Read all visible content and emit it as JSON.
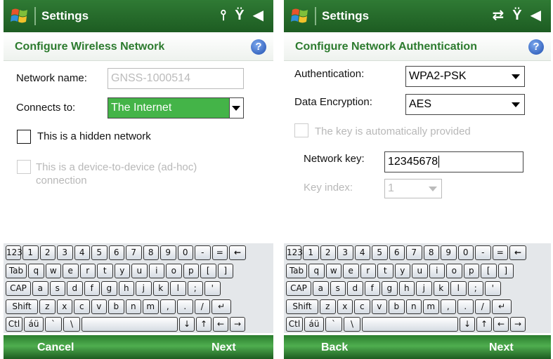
{
  "left": {
    "title": "Settings",
    "status_icons": [
      "signal-icon",
      "antenna-off-icon",
      "speaker-off-icon"
    ],
    "heading": "Configure Wireless Network",
    "network_name_label": "Network name:",
    "network_name_value": "GNSS-1000514",
    "connects_to_label": "Connects to:",
    "connects_to_value": "The Internet",
    "hidden_network_label": "This is a hidden network",
    "adhoc_label_line1": "This is a device-to-device (ad-hoc)",
    "adhoc_label_line2": "connection",
    "softkey_left": "Cancel",
    "softkey_right": "Next"
  },
  "right": {
    "title": "Settings",
    "status_icons": [
      "connectivity-icon",
      "antenna-off-icon",
      "speaker-off-icon"
    ],
    "heading": "Configure Network Authentication",
    "authentication_label": "Authentication:",
    "authentication_value": "WPA2-PSK",
    "data_encryption_label": "Data Encryption:",
    "data_encryption_value": "AES",
    "auto_key_label": "The key is automatically provided",
    "network_key_label": "Network key:",
    "network_key_value": "12345678",
    "key_index_label": "Key index:",
    "key_index_value": "1",
    "softkey_left": "Back",
    "softkey_right": "Next"
  },
  "keyboard": {
    "rows": [
      [
        "123",
        "1",
        "2",
        "3",
        "4",
        "5",
        "6",
        "7",
        "8",
        "9",
        "0",
        "-",
        "=",
        "←"
      ],
      [
        "Tab",
        "q",
        "w",
        "e",
        "r",
        "t",
        "y",
        "u",
        "i",
        "o",
        "p",
        "[",
        "]"
      ],
      [
        "CAP",
        "a",
        "s",
        "d",
        "f",
        "g",
        "h",
        "j",
        "k",
        "l",
        ";",
        "'"
      ],
      [
        "Shift",
        "z",
        "x",
        "c",
        "v",
        "b",
        "n",
        "m",
        ",",
        ".",
        "/",
        "↵"
      ],
      [
        "Ctl",
        "áü",
        "`",
        "\\",
        " ",
        "↓",
        "↑",
        "←",
        "→"
      ]
    ]
  },
  "colors": {
    "titlebar": "#1d5c22",
    "heading_text": "#2c7b2e",
    "selected_field": "#44b448",
    "help_icon": "#1f4fb0"
  }
}
